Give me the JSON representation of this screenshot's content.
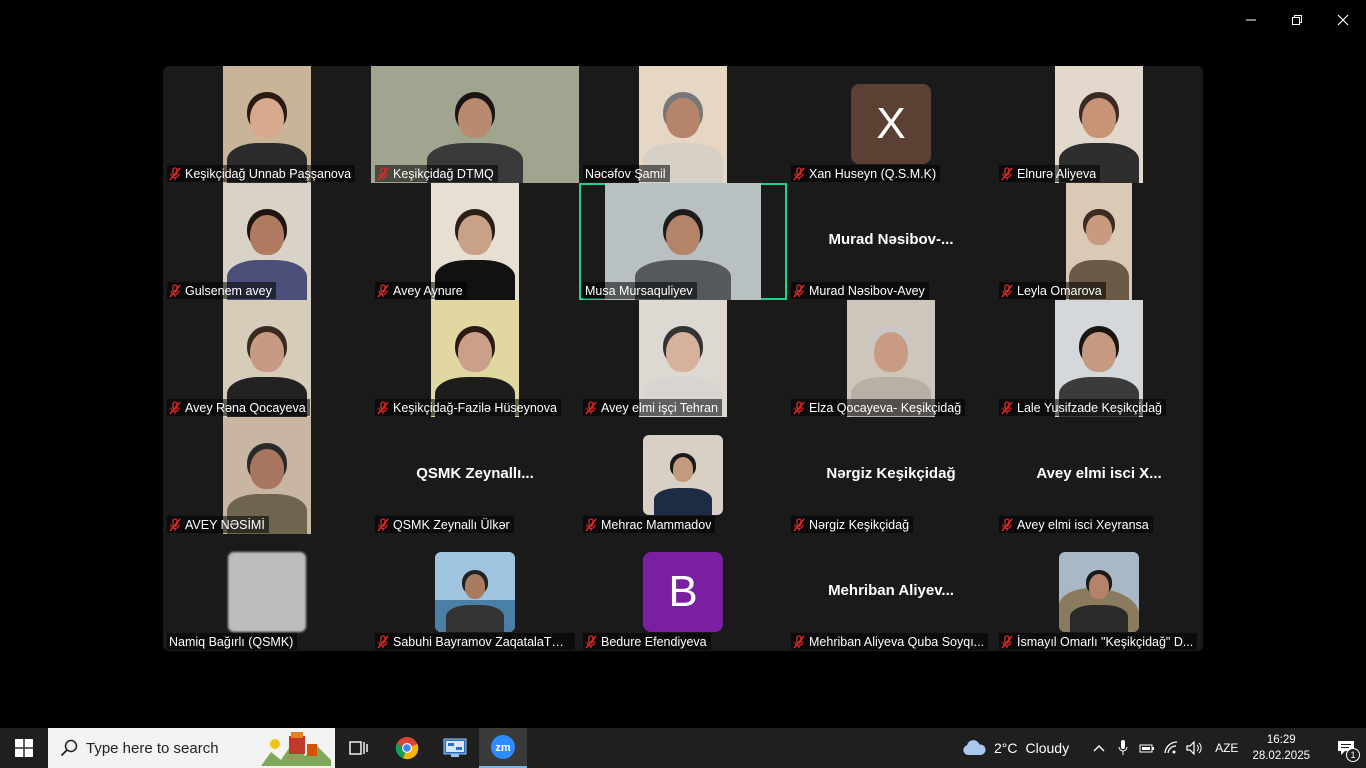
{
  "gallery": {
    "tiles": [
      {
        "name": "Keşikçidağ Unnab Paşşanova",
        "muted": true
      },
      {
        "name": "Keşikçidağ DTMQ",
        "muted": true
      },
      {
        "name": "Nəcəfov Şamil",
        "muted": false
      },
      {
        "name": "Xan Huseyn (Q.S.M.K)",
        "muted": true,
        "avatar_letter": "X",
        "avatar_color": "#5c4033"
      },
      {
        "name": "Elnurə  Aliyeva",
        "muted": true
      },
      {
        "name": "Gulsenem avey",
        "muted": true
      },
      {
        "name": "Avey Aynure",
        "muted": true
      },
      {
        "name": "Musa Mursaquliyev",
        "muted": false,
        "active_speaker": true
      },
      {
        "name": "Murad Nəsibov-Avey",
        "muted": true,
        "display_name": "Murad  Nəsibov-..."
      },
      {
        "name": "Leyla Omarova",
        "muted": true
      },
      {
        "name": "Avey Rəna Qocayeva",
        "muted": true
      },
      {
        "name": "Keşikçidağ-Fazilə Hüseynova",
        "muted": true
      },
      {
        "name": "Avey elmi işçi Tehran",
        "muted": true
      },
      {
        "name": "Elza Qocayeva- Keşikçidağ",
        "muted": true
      },
      {
        "name": "Lale Yusifzade Keşikçidağ",
        "muted": true
      },
      {
        "name": "AVEY NƏSİMİ",
        "muted": true
      },
      {
        "name": "QSMK Zeynallı Ülkər",
        "muted": true,
        "display_name": "QSMK  Zeynallı..."
      },
      {
        "name": "Mehrac Mammadov",
        "muted": true
      },
      {
        "name": "Nərgiz Keşikçidağ",
        "muted": true,
        "display_name": "Nərgiz Keşikçidağ"
      },
      {
        "name": "Avey elmi isci Xeyransa",
        "muted": true,
        "display_name": "Avey elmi isci X..."
      },
      {
        "name": "Namiq Bağırlı (QSMK)",
        "muted": false
      },
      {
        "name": "Sabuhi Bayramov ZaqatalaTM...",
        "muted": true
      },
      {
        "name": "Bedure Efendiyeva",
        "muted": true,
        "avatar_letter": "B",
        "avatar_color": "#7b1fa2"
      },
      {
        "name": "Mehriban Aliyeva Quba Soyqı...",
        "muted": true,
        "display_name": "Mehriban  Aliyev..."
      },
      {
        "name": "İsmayıl Omarlı \"Keşikçidağ\" D...",
        "muted": true
      }
    ]
  },
  "taskbar": {
    "search_placeholder": "Type here to search",
    "weather": {
      "temp": "2°C",
      "condition": "Cloudy"
    },
    "language": "AZE",
    "time": "16:29",
    "date": "28.02.2025",
    "notification_count": "1"
  },
  "colors": {
    "active_speaker": "#23d18b",
    "muted_icon": "#e02828",
    "tile_bg": "#1a1a1a"
  }
}
